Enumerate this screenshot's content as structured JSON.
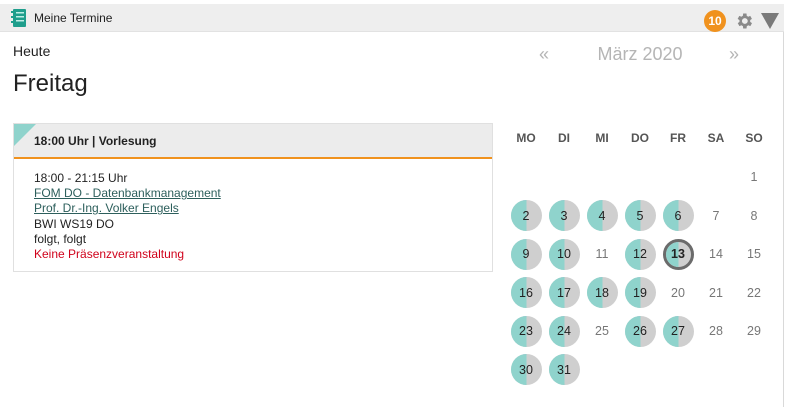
{
  "header": {
    "title": "Meine Termine",
    "icon": "calendar-book-icon",
    "badge_count": "10",
    "settings_icon": "gear-icon",
    "menu_icon": "triangle-down-icon",
    "accent_color": "#f0921e"
  },
  "day_view": {
    "label": "Heute",
    "day_name": "Freitag"
  },
  "event": {
    "header": "18:00 Uhr | Vorlesung",
    "time": "18:00 - 21:15 Uhr",
    "course": "FOM DO - Datenbankmanagement",
    "lecturer": "Prof. Dr.-Ing. Volker Engels",
    "group": "BWI WS19 DO",
    "room": "folgt, folgt",
    "note": "Keine Präsenzveranstaltung",
    "note_color": "#d0021b",
    "corner_color": "#8fd3cc"
  },
  "calendar": {
    "prev": "«",
    "next": "»",
    "month_title": "März 2020",
    "weekdays": [
      "MO",
      "DI",
      "MI",
      "DO",
      "FR",
      "SA",
      "SO"
    ],
    "leading_blanks": 6,
    "days_in_month": 31,
    "event_days": [
      2,
      3,
      4,
      5,
      6,
      9,
      10,
      12,
      13,
      16,
      17,
      18,
      19,
      23,
      24,
      26,
      27,
      30,
      31
    ],
    "today": 13
  }
}
